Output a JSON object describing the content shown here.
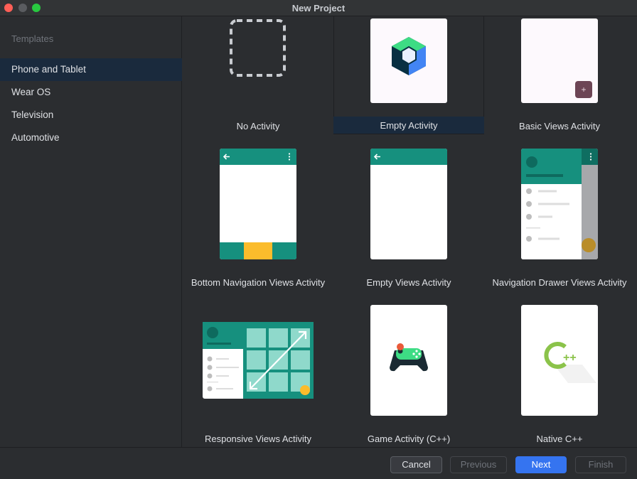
{
  "window": {
    "title": "New Project"
  },
  "sidebar": {
    "heading": "Templates",
    "items": [
      {
        "label": "Phone and Tablet",
        "selected": true
      },
      {
        "label": "Wear OS",
        "selected": false
      },
      {
        "label": "Television",
        "selected": false
      },
      {
        "label": "Automotive",
        "selected": false
      }
    ]
  },
  "templates": [
    {
      "label": "No Activity",
      "selected": false,
      "icon": "dashed-square-icon"
    },
    {
      "label": "Empty Activity",
      "selected": true,
      "icon": "compose-logo-icon"
    },
    {
      "label": "Basic Views Activity",
      "selected": false,
      "icon": "fab-plus-icon"
    },
    {
      "label": "Bottom Navigation Views Activity",
      "selected": false,
      "icon": "bottom-nav-phone-icon"
    },
    {
      "label": "Empty Views Activity",
      "selected": false,
      "icon": "empty-phone-icon"
    },
    {
      "label": "Navigation Drawer Views Activity",
      "selected": false,
      "icon": "nav-drawer-phone-icon"
    },
    {
      "label": "Responsive Views Activity",
      "selected": false,
      "icon": "responsive-tablet-icon"
    },
    {
      "label": "Game Activity (C++)",
      "selected": false,
      "icon": "gamepad-icon"
    },
    {
      "label": "Native C++",
      "selected": false,
      "icon": "cpp-logo-icon"
    }
  ],
  "preview_glyphs": {
    "plus": "+",
    "cpp": "++"
  },
  "colors": {
    "teal": "#16907e",
    "amber": "#fbbc2c",
    "accent": "#3574f0",
    "selection": "#1a2a3d"
  },
  "buttons": {
    "cancel": "Cancel",
    "previous": "Previous",
    "next": "Next",
    "finish": "Finish"
  }
}
